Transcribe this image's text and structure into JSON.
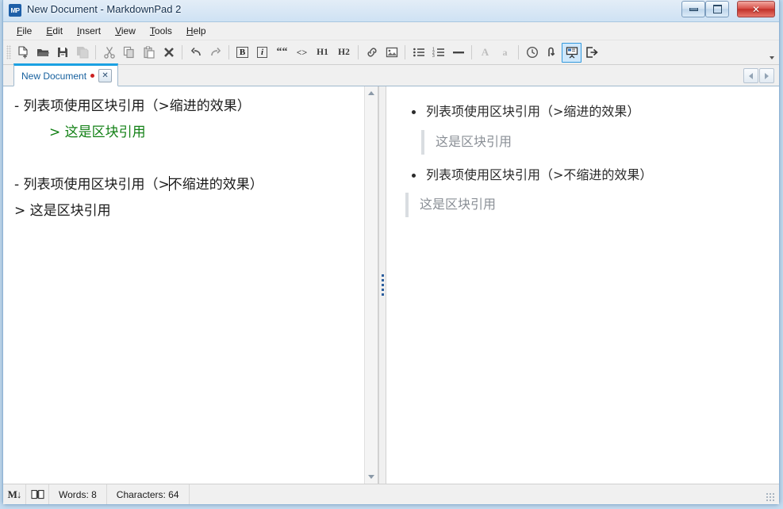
{
  "window": {
    "title": "New Document - MarkdownPad 2",
    "app_icon_label": "MP",
    "caption_buttons": {
      "minimize": "Minimize",
      "maximize": "Restore",
      "close": "✕"
    }
  },
  "menubar": {
    "items": [
      {
        "label": "File",
        "mnemonic": "F",
        "rest": "ile"
      },
      {
        "label": "Edit",
        "mnemonic": "E",
        "rest": "dit"
      },
      {
        "label": "Insert",
        "mnemonic": "I",
        "rest": "nsert"
      },
      {
        "label": "View",
        "mnemonic": "V",
        "rest": "iew"
      },
      {
        "label": "Tools",
        "mnemonic": "T",
        "rest": "ools"
      },
      {
        "label": "Help",
        "mnemonic": "H",
        "rest": "elp"
      }
    ]
  },
  "toolbar": {
    "buttons": [
      {
        "name": "new-document-icon",
        "type": "icon",
        "label": "New"
      },
      {
        "name": "open-folder-icon",
        "type": "icon",
        "label": "Open"
      },
      {
        "name": "save-icon",
        "type": "icon",
        "label": "Save"
      },
      {
        "name": "save-all-icon",
        "type": "icon",
        "label": "Save All"
      },
      {
        "name": "separator",
        "type": "sep",
        "label": ""
      },
      {
        "name": "cut-icon",
        "type": "icon",
        "label": "Cut"
      },
      {
        "name": "copy-icon",
        "type": "icon",
        "label": "Copy"
      },
      {
        "name": "paste-icon",
        "type": "icon",
        "label": "Paste"
      },
      {
        "name": "delete-icon",
        "type": "icon",
        "label": "Delete"
      },
      {
        "name": "separator",
        "type": "sep",
        "label": ""
      },
      {
        "name": "undo-icon",
        "type": "icon",
        "label": "Undo"
      },
      {
        "name": "redo-icon",
        "type": "icon",
        "label": "Redo"
      },
      {
        "name": "separator",
        "type": "sep",
        "label": ""
      },
      {
        "name": "bold-icon",
        "type": "text",
        "label": "B"
      },
      {
        "name": "italic-icon",
        "type": "text",
        "label": "i"
      },
      {
        "name": "blockquote-icon",
        "type": "text",
        "label": "““"
      },
      {
        "name": "inline-code-icon",
        "type": "text",
        "label": "<>"
      },
      {
        "name": "heading-1-icon",
        "type": "text",
        "label": "H1"
      },
      {
        "name": "heading-2-icon",
        "type": "text",
        "label": "H2"
      },
      {
        "name": "separator",
        "type": "sep",
        "label": ""
      },
      {
        "name": "link-icon",
        "type": "icon",
        "label": "Link"
      },
      {
        "name": "image-icon",
        "type": "icon",
        "label": "Image"
      },
      {
        "name": "separator",
        "type": "sep",
        "label": ""
      },
      {
        "name": "bullet-list-icon",
        "type": "icon",
        "label": "Bullet List"
      },
      {
        "name": "numbered-list-icon",
        "type": "icon",
        "label": "Numbered List"
      },
      {
        "name": "horizontal-rule-icon",
        "type": "icon",
        "label": "Horizontal Rule"
      },
      {
        "name": "separator",
        "type": "sep",
        "label": ""
      },
      {
        "name": "uppercase-icon",
        "type": "text",
        "label": "A",
        "disabled": true
      },
      {
        "name": "lowercase-icon",
        "type": "text",
        "label": "a",
        "disabled": true
      },
      {
        "name": "separator",
        "type": "sep",
        "label": ""
      },
      {
        "name": "timestamp-icon",
        "type": "icon",
        "label": "Insert Time"
      },
      {
        "name": "line-break-icon",
        "type": "icon",
        "label": "Line Break"
      },
      {
        "name": "presentation-icon",
        "type": "icon",
        "label": "Presentation Mode",
        "active": true
      },
      {
        "name": "export-icon",
        "type": "icon",
        "label": "Export"
      }
    ],
    "overflow_label": "More toolbar buttons"
  },
  "tabbar": {
    "tab": {
      "label": "New Document",
      "modified": true,
      "close_label": "✕"
    },
    "nav_left_label": "Scroll tabs left",
    "nav_right_label": "Scroll tabs right"
  },
  "editor": {
    "lines": [
      {
        "text": "- 列表项使用区块引用（>缩进的效果）",
        "style": "normal"
      },
      {
        "text": "> 这是区块引用",
        "style": "quote"
      },
      {
        "text": "",
        "style": "normal"
      },
      {
        "text": "- 列表项使用区块引用（>",
        "after_caret": "不缩进的效果）",
        "style": "caret"
      },
      {
        "text": "> 这是区块引用",
        "style": "normal"
      }
    ]
  },
  "preview": {
    "blocks": [
      {
        "kind": "list-item",
        "text": "列表项使用区块引用（>缩进的效果）"
      },
      {
        "kind": "blockquote-indent",
        "text": "这是区块引用"
      },
      {
        "kind": "list-item",
        "text": "列表项使用区块引用（>不缩进的效果）"
      },
      {
        "kind": "blockquote",
        "text": "这是区块引用"
      }
    ]
  },
  "statusbar": {
    "markdown_icon": "M↓",
    "book_icon": "📖",
    "words": "Words: 8",
    "characters": "Characters: 64"
  },
  "colors": {
    "accent": "#1ba1e2",
    "quote_green": "#128015",
    "tab_text": "#16609e",
    "close_red": "#c03028"
  }
}
